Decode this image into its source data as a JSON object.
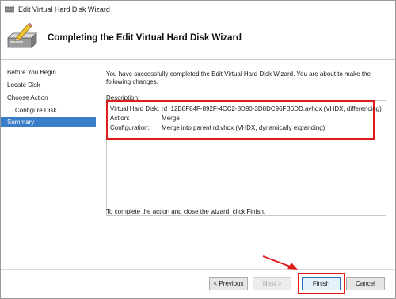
{
  "window": {
    "title": "Edit Virtual Hard Disk Wizard"
  },
  "header": {
    "heading": "Completing the Edit Virtual Hard Disk Wizard"
  },
  "nav": {
    "items": [
      {
        "label": "Before You Begin",
        "sub": false,
        "active": false
      },
      {
        "label": "Locate Disk",
        "sub": false,
        "active": false
      },
      {
        "label": "Choose Action",
        "sub": false,
        "active": false
      },
      {
        "label": "Configure Disk",
        "sub": true,
        "active": false
      },
      {
        "label": "Summary",
        "sub": false,
        "active": true
      }
    ]
  },
  "content": {
    "intro": "You have successfully completed the Edit Virtual Hard Disk Wizard. You are about to make the following changes.",
    "description_label": "Description:",
    "rows": [
      {
        "key": "Virtual Hard Disk:",
        "value": "rd_12B8F84F-892F-4CC2-8D90-3D8DC96FB6DD.avhdx (VHDX, differencing)"
      },
      {
        "key": "Action:",
        "value": "Merge"
      },
      {
        "key": "Configuration:",
        "value": "Merge into parent rd.vhdx (VHDX, dynamically expanding)"
      }
    ],
    "outro": "To complete the action and close the wizard, click Finish."
  },
  "buttons": {
    "previous": "< Previous",
    "next": "Next >",
    "finish": "Finish",
    "cancel": "Cancel"
  },
  "colors": {
    "highlight": "#e11a1a",
    "selected": "#3a7dc9"
  },
  "icons": {
    "app": "virtual-disk-icon",
    "wizard": "disk-pencil-icon"
  }
}
